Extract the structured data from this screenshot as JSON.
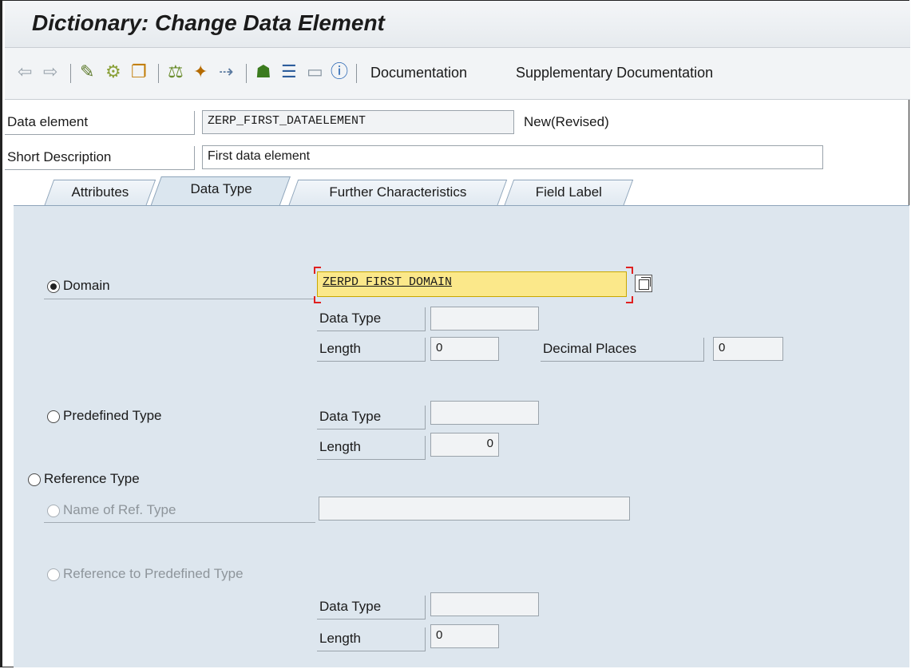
{
  "title": "Dictionary: Change Data Element",
  "toolbar": {
    "documentation": "Documentation",
    "supplementary": "Supplementary Documentation"
  },
  "header": {
    "data_element_label": "Data element",
    "data_element_value": "ZERP_FIRST_DATAELEMENT",
    "status": "New(Revised)",
    "short_desc_label": "Short Description",
    "short_desc_value": "First data element"
  },
  "tabs": [
    {
      "label": "Attributes"
    },
    {
      "label": "Data Type"
    },
    {
      "label": "Further Characteristics"
    },
    {
      "label": "Field Label"
    }
  ],
  "datatype": {
    "domain_label": "Domain",
    "domain_value": "ZERPD_FIRST_DOMAIN",
    "dt_label": "Data Type",
    "length_label": "Length",
    "length_value": "0",
    "decimal_label": "Decimal Places",
    "decimal_value": "0",
    "predefined_label": "Predefined Type",
    "pre_dt_label": "Data Type",
    "pre_length_label": "Length",
    "pre_length_value": "0",
    "reference_label": "Reference Type",
    "name_ref_label": "Name of Ref. Type",
    "ref_predef_label": "Reference to Predefined Type",
    "ref_dt_label": "Data Type",
    "ref_length_label": "Length",
    "ref_length_value": "0"
  }
}
